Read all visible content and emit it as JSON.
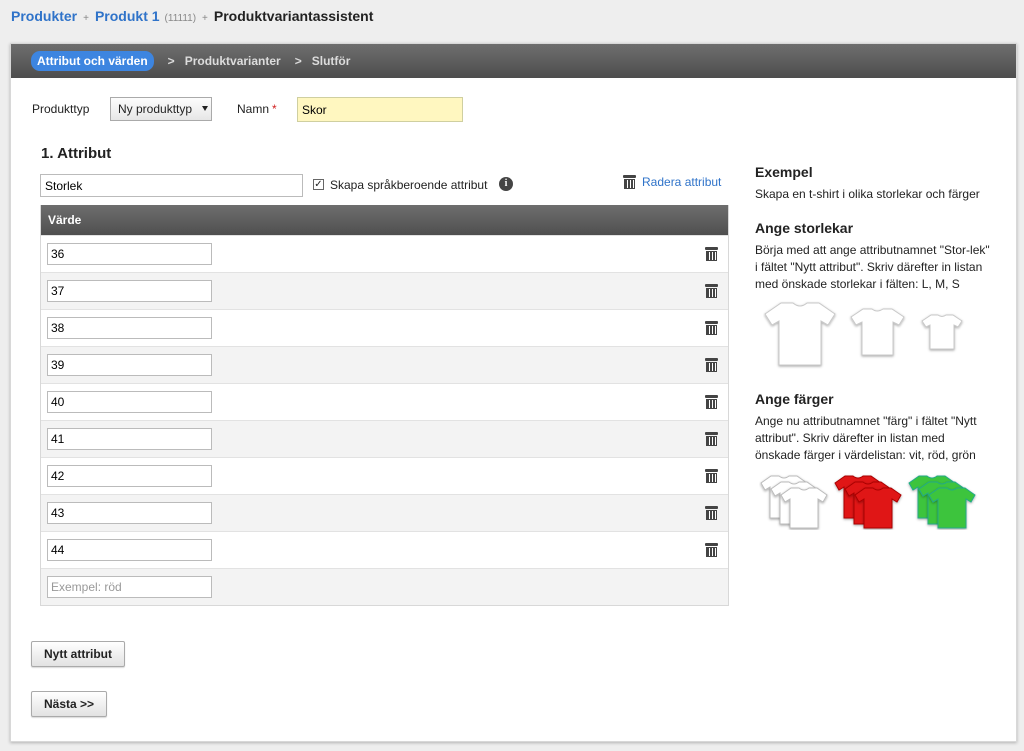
{
  "breadcrumb": {
    "products": "Produkter",
    "product": "Produkt 1",
    "product_id": "(11111)",
    "current": "Produktvariantassistent"
  },
  "wizard": {
    "steps": [
      "Attribut och värden",
      "Produktvarianter",
      "Slutför"
    ],
    "active_step": 0,
    "separator": ">"
  },
  "form": {
    "type_label": "Produkttyp",
    "type_value": "Ny produkttyp",
    "name_label": "Namn",
    "required_mark": "*",
    "name_value": "Skor"
  },
  "attribute": {
    "heading": "1. Attribut",
    "name_value": "Storlek",
    "language_checkbox_label": "Skapa språkberoende attribut",
    "language_checkbox_checked": true,
    "delete_label": "Radera attribut",
    "table_header": "Värde",
    "values": [
      "36",
      "37",
      "38",
      "39",
      "40",
      "41",
      "42",
      "43",
      "44"
    ],
    "new_value_placeholder": "Exempel: röd"
  },
  "buttons": {
    "new_attribute": "Nytt attribut",
    "next": "Nästa >>"
  },
  "example": {
    "title": "Exempel",
    "intro": "Skapa en t-shirt i olika storlekar och färger",
    "sizes_title": "Ange storlekar",
    "sizes_text": "Börja med att ange attributnamnet \"Stor-lek\" i fältet \"Nytt attribut\". Skriv därefter in listan med önskade storlekar i fälten: L, M, S",
    "colors_title": "Ange färger",
    "colors_text": "Ange nu attributnamnet \"färg\" i fältet \"Nytt attribut\". Skriv därefter in listan med önskade färger i värdelistan: vit, röd, grön"
  },
  "colors": {
    "accent": "#3d85e0",
    "link": "#2f73c9",
    "header_bar": "#5a5a5a",
    "highlight_input": "#fff7c0",
    "shirt_white": "#ffffff",
    "shirt_red": "#e01515",
    "shirt_green": "#3cc43c"
  },
  "icons": {
    "delete": "trash-icon",
    "info": "info-icon",
    "dropdown": "chevron-down-icon"
  }
}
